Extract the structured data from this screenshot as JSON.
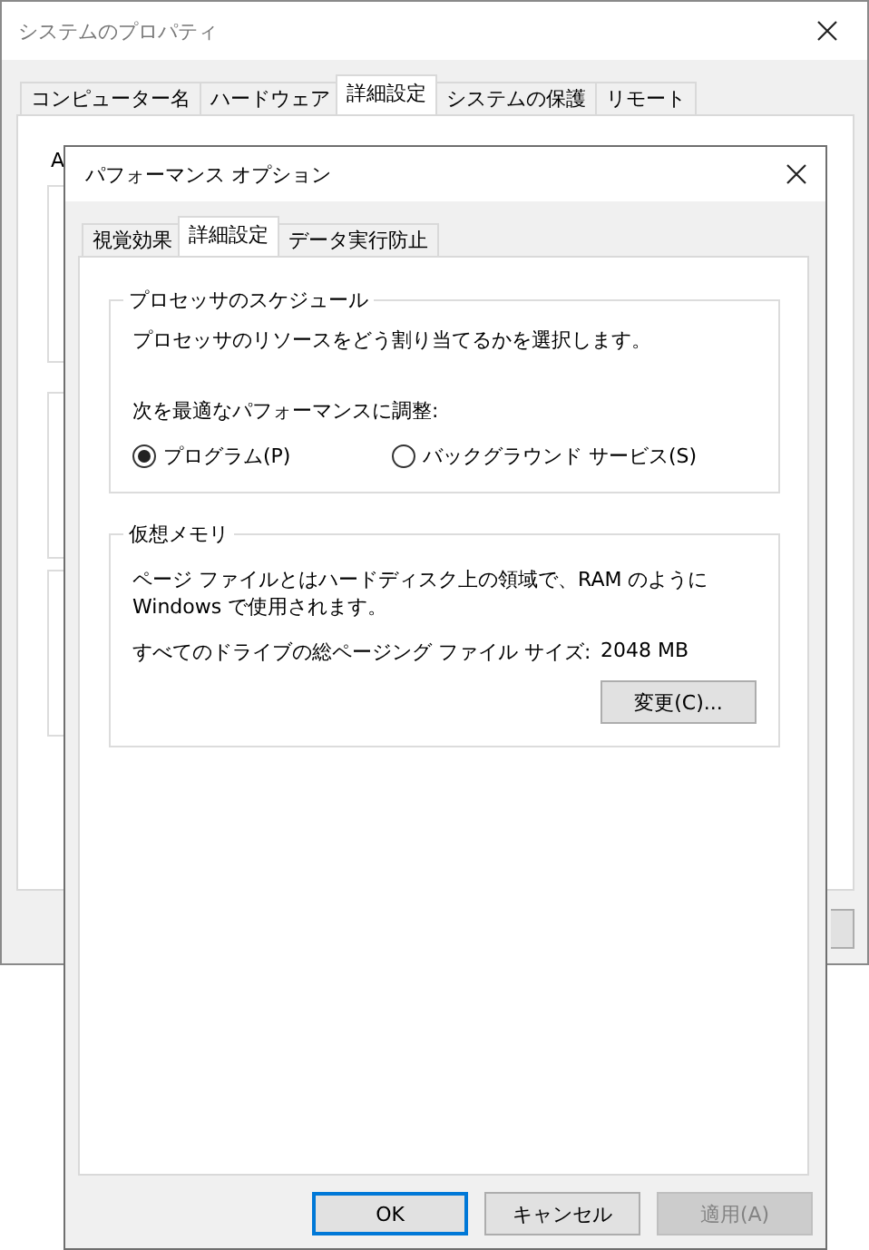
{
  "background_window": {
    "title": "システムのプロパティ",
    "partial_text": "A",
    "tabs": [
      {
        "label": "コンピューター名",
        "selected": false
      },
      {
        "label": "ハードウェア",
        "selected": false
      },
      {
        "label": "詳細設定",
        "selected": true
      },
      {
        "label": "システムの保護",
        "selected": false
      },
      {
        "label": "リモート",
        "selected": false
      }
    ]
  },
  "dialog": {
    "title": "パフォーマンス オプション",
    "tabs": [
      {
        "label": "視覚効果",
        "selected": false
      },
      {
        "label": "詳細設定",
        "selected": true
      },
      {
        "label": "データ実行防止",
        "selected": false
      }
    ],
    "processor_group": {
      "legend": "プロセッサのスケジュール",
      "description": "プロセッサのリソースをどう割り当てるかを選択します。",
      "adjust_label": "次を最適なパフォーマンスに調整:",
      "options": [
        {
          "label": "プログラム(P)",
          "selected": true
        },
        {
          "label": "バックグラウンド サービス(S)",
          "selected": false
        }
      ]
    },
    "memory_group": {
      "legend": "仮想メモリ",
      "description": "ページ ファイルとはハードディスク上の領域で、RAM のように Windows で使用されます。",
      "size_label": "すべてのドライブの総ページング ファイル サイズ:",
      "size_value": "2048 MB",
      "change_button": "変更(C)..."
    },
    "buttons": [
      {
        "label": "OK",
        "default": true,
        "disabled": false
      },
      {
        "label": "キャンセル",
        "default": false,
        "disabled": false
      },
      {
        "label": "適用(A)",
        "default": false,
        "disabled": true
      }
    ]
  }
}
